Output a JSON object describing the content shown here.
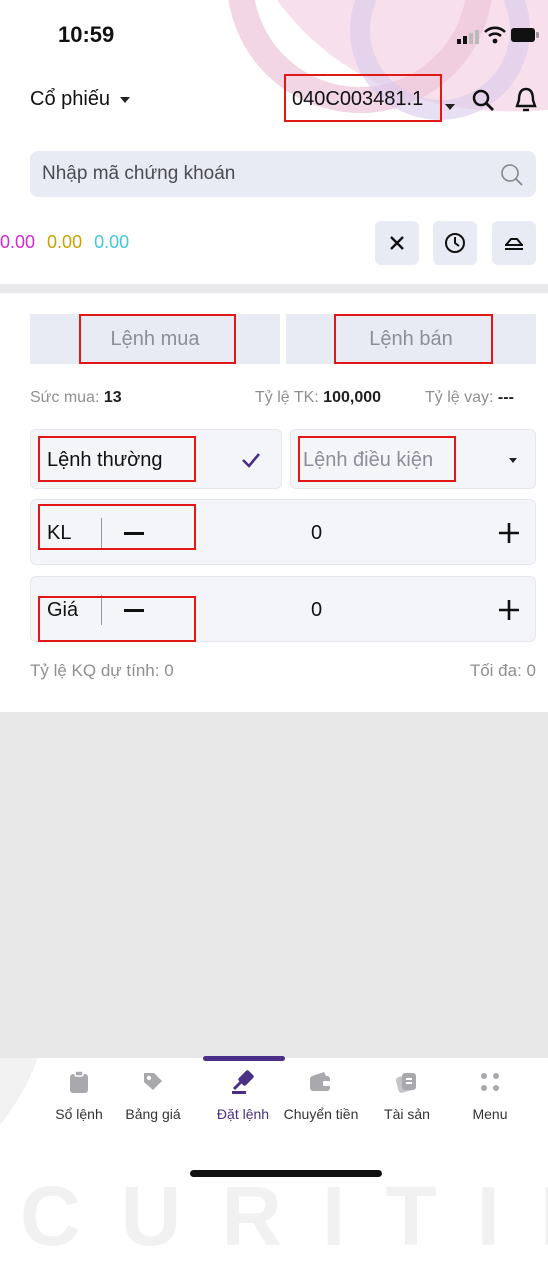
{
  "status_bar": {
    "time": "10:59"
  },
  "header": {
    "stock_type_label": "Cổ phiếu",
    "account_number": "040C003481.1"
  },
  "search": {
    "placeholder": "Nhập mã chứng khoán"
  },
  "indexes": {
    "values": [
      "0.00",
      "0.00",
      "0.00"
    ],
    "colors": [
      "#d12ad4",
      "#c9a100",
      "#41c8e0"
    ]
  },
  "order_tabs": {
    "buy": "Lệnh mua",
    "sell": "Lệnh bán"
  },
  "account_info": {
    "buying_power_label": "Sức mua:",
    "buying_power_value": "13",
    "tk_ratio_label": "Tỷ lệ TK:",
    "tk_ratio_value": "100,000",
    "loan_ratio_label": "Tỷ lệ vay:",
    "loan_ratio_value": "---"
  },
  "order_type": {
    "normal": "Lệnh thường",
    "conditional": "Lệnh điều kiện"
  },
  "quantity": {
    "label": "KL",
    "value": "0"
  },
  "price": {
    "label": "Giá",
    "value": "0"
  },
  "estimate": {
    "ratio_label": "Tỷ lệ KQ dự tính: 0",
    "max_label": "Tối đa: 0"
  },
  "bottom_nav": {
    "items": [
      {
        "label": "Sổ lệnh",
        "icon": "clipboard-icon"
      },
      {
        "label": "Bảng giá",
        "icon": "tag-icon"
      },
      {
        "label": "Đặt lệnh",
        "icon": "gavel-icon",
        "active": true
      },
      {
        "label": "Chuyển tiền",
        "icon": "wallet-icon"
      },
      {
        "label": "Tài sản",
        "icon": "assets-icon"
      },
      {
        "label": "Menu",
        "icon": "menu-dots-icon"
      }
    ],
    "active_color": "#4a2f86"
  },
  "watermark": "CURITIES"
}
